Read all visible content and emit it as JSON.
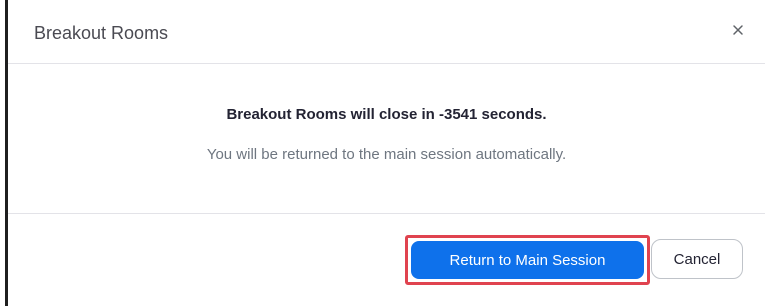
{
  "dialog": {
    "title": "Breakout Rooms",
    "close_icon": "close-icon"
  },
  "message": {
    "title": "Breakout Rooms will close in -3541 seconds.",
    "subtitle": "You will be returned to the main session automatically."
  },
  "actions": {
    "primary_label": "Return to Main Session",
    "secondary_label": "Cancel"
  },
  "colors": {
    "primary": "#0e71eb",
    "highlight": "#e0434f",
    "title_text": "#232333",
    "muted_text": "#6e7680"
  }
}
